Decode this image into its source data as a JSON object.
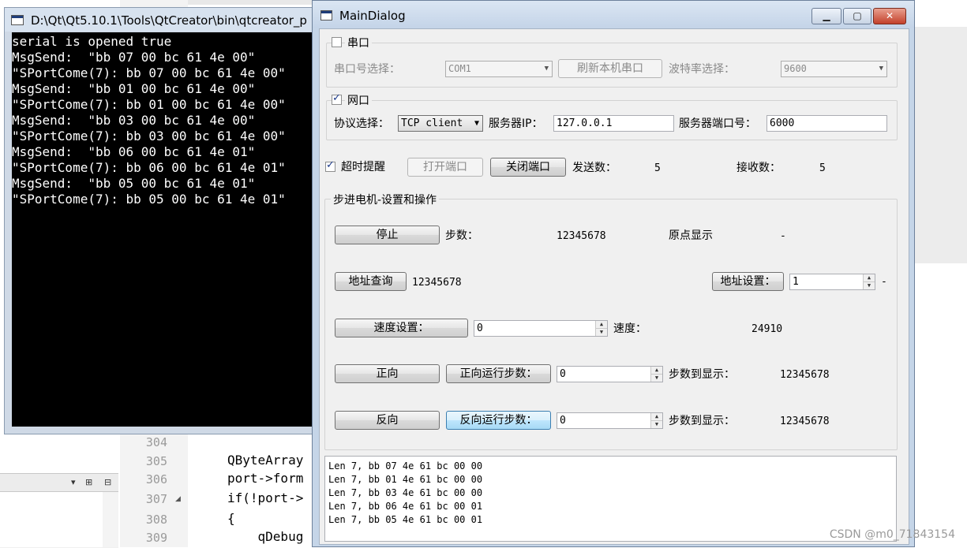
{
  "ide": {
    "lines": [
      {
        "num": "304",
        "code": ""
      },
      {
        "num": "305",
        "code": "QByteArray"
      },
      {
        "num": "306",
        "code": "port->form"
      },
      {
        "num": "307",
        "code": "if(!port->"
      },
      {
        "num": "308",
        "code": "{"
      },
      {
        "num": "309",
        "code": "    qDebug"
      }
    ],
    "panel_icons": [
      "▾",
      "⊞",
      "⊟"
    ]
  },
  "console": {
    "title": "D:\\Qt\\Qt5.10.1\\Tools\\QtCreator\\bin\\qtcreator_p",
    "lines": [
      "serial is opened true",
      "MsgSend:  \"bb 07 00 bc 61 4e 00\"",
      "\"SPortCome(7): bb 07 00 bc 61 4e 00\"",
      "MsgSend:  \"bb 01 00 bc 61 4e 00\"",
      "\"SPortCome(7): bb 01 00 bc 61 4e 00\"",
      "MsgSend:  \"bb 03 00 bc 61 4e 00\"",
      "\"SPortCome(7): bb 03 00 bc 61 4e 00\"",
      "MsgSend:  \"bb 06 00 bc 61 4e 01\"",
      "\"SPortCome(7): bb 06 00 bc 61 4e 01\"",
      "MsgSend:  \"bb 05 00 bc 61 4e 01\"",
      "\"SPortCome(7): bb 05 00 bc 61 4e 01\""
    ]
  },
  "dialog": {
    "title": "MainDialog",
    "window_buttons": {
      "minimize": "▁",
      "maximize": "▢",
      "close": "✕"
    },
    "serial_group": {
      "title": "串口",
      "checked": false,
      "port_label": "串口号选择：",
      "port_value": "COM1",
      "refresh_button": "刷新本机串口",
      "baud_label": "波特率选择：",
      "baud_value": "9600"
    },
    "network_group": {
      "title": "网口",
      "checked": true,
      "protocol_label": "协议选择：",
      "protocol_value": "TCP client",
      "ip_label": "服务器IP：",
      "ip_value": "127.0.0.1",
      "port_label": "服务器端口号：",
      "port_value": "6000"
    },
    "controls": {
      "timeout_label": "超时提醒",
      "timeout_checked": true,
      "open_port_button": "打开端口",
      "close_port_button": "关闭端口",
      "send_count_label": "发送数：",
      "send_count": "5",
      "recv_count_label": "接收数：",
      "recv_count": "5"
    },
    "motor_group": {
      "title": "步进电机-设置和操作",
      "stop_button": "停止",
      "steps_label": "步数：",
      "steps_value": "12345678",
      "origin_label": "原点显示",
      "origin_value": "-",
      "addr_query_button": "地址查询",
      "addr_value": "12345678",
      "addr_set_button": "地址设置：",
      "addr_set_value": "1",
      "addr_set_suffix": "-",
      "speed_set_button": "速度设置：",
      "speed_set_value": "0",
      "speed_label": "速度：",
      "speed_value": "24910",
      "forward_button": "正向",
      "forward_steps_button": "正向运行步数：",
      "forward_steps_value": "0",
      "forward_reach_label": "步数到显示：",
      "forward_reach_value": "12345678",
      "reverse_button": "反向",
      "reverse_steps_button": "反向运行步数：",
      "reverse_steps_value": "0",
      "reverse_reach_label": "步数到显示：",
      "reverse_reach_value": "12345678"
    },
    "log_lines": [
      "Len 7, bb 07 4e 61 bc 00 00",
      "Len 7, bb 01 4e 61 bc 00 00",
      "Len 7, bb 03 4e 61 bc 00 00",
      "Len 7, bb 06 4e 61 bc 00 01",
      "Len 7, bb 05 4e 61 bc 00 01"
    ]
  },
  "watermark": "CSDN @m0_71843154"
}
